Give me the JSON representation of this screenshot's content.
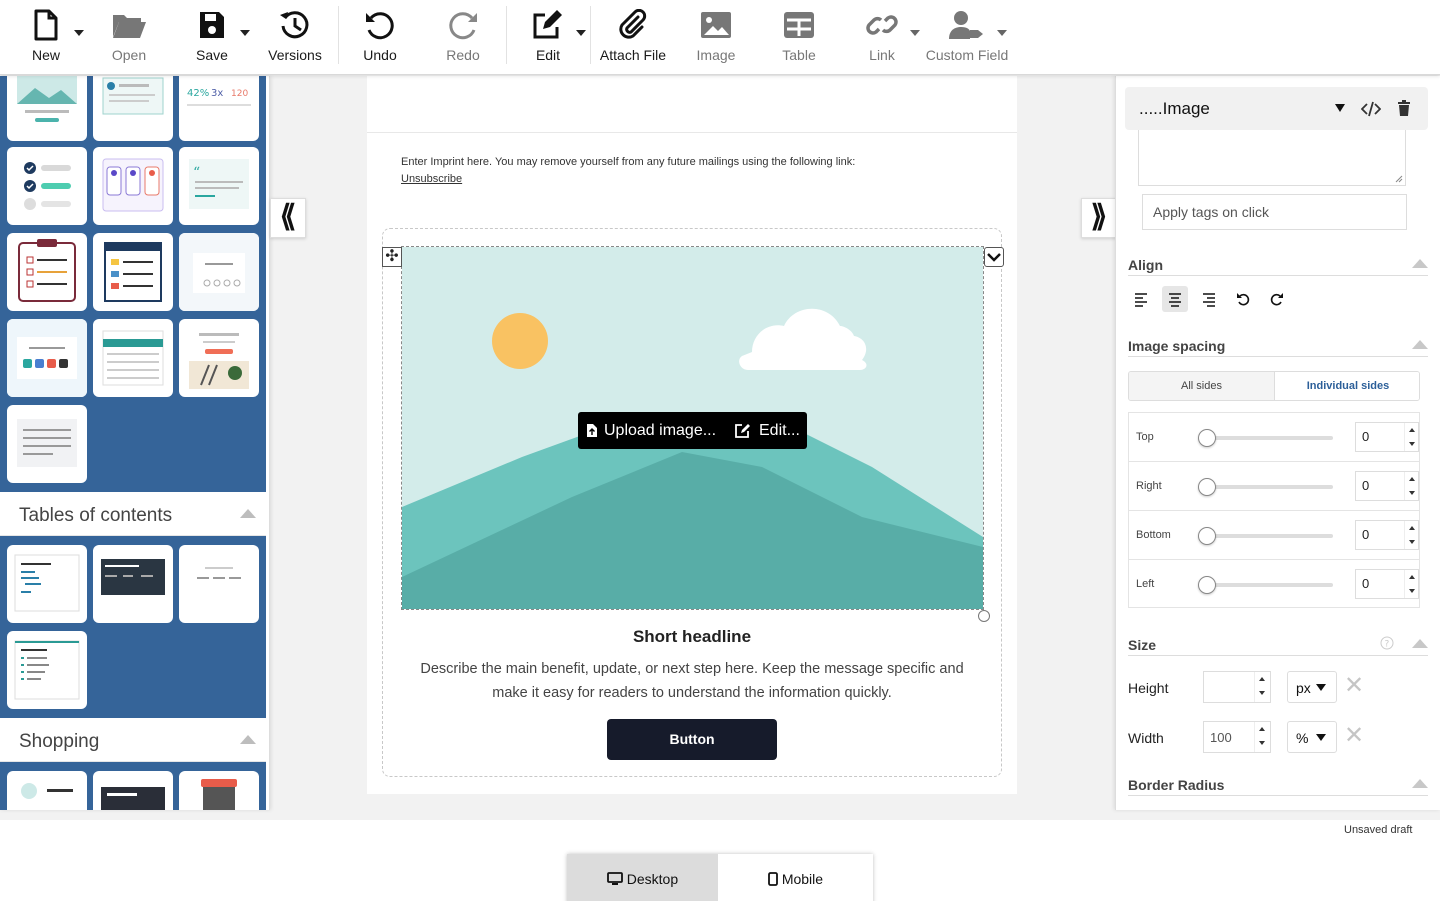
{
  "toolbar": {
    "new": "New",
    "open": "Open",
    "save": "Save",
    "versions": "Versions",
    "undo": "Undo",
    "redo": "Redo",
    "edit": "Edit",
    "attach": "Attach File",
    "image": "Image",
    "table": "Table",
    "link": "Link",
    "custom_field": "Custom Field"
  },
  "left_panel": {
    "sections": [
      {
        "title": "Tables of contents"
      },
      {
        "title": "Shopping"
      }
    ]
  },
  "canvas": {
    "imprint_text": "Enter Imprint here. You may remove yourself from any future mailings using the following link:",
    "unsubscribe": "Unsubscribe",
    "upload_label": "Upload image...",
    "edit_label": "Edit...",
    "headline": "Short headline",
    "body": "Describe the main benefit, update, or next step here. Keep the message specific and make it easy for readers to understand the information quickly.",
    "button": "Button"
  },
  "right_panel": {
    "block_title": ".....Image",
    "tags_placeholder": "Apply tags on click",
    "align_title": "Align",
    "spacing_title": "Image spacing",
    "spacing_modes": [
      "All sides",
      "Individual sides"
    ],
    "spacing_rows": [
      {
        "label": "Top",
        "value": "0"
      },
      {
        "label": "Right",
        "value": "0"
      },
      {
        "label": "Bottom",
        "value": "0"
      },
      {
        "label": "Left",
        "value": "0"
      }
    ],
    "size_title": "Size",
    "height_label": "Height",
    "height_value": "",
    "height_unit": "px",
    "width_label": "Width",
    "width_value": "100",
    "width_unit": "%",
    "border_radius_title": "Border Radius"
  },
  "status": {
    "draft": "Unsaved draft"
  },
  "view": {
    "desktop": "Desktop",
    "mobile": "Mobile"
  },
  "colors": {
    "sidebar_blue": "#356499",
    "hero_bg": "#d3ecea",
    "hero_mountain": "#5fb8b2",
    "sun": "#f9c262",
    "cta": "#161b2b"
  }
}
